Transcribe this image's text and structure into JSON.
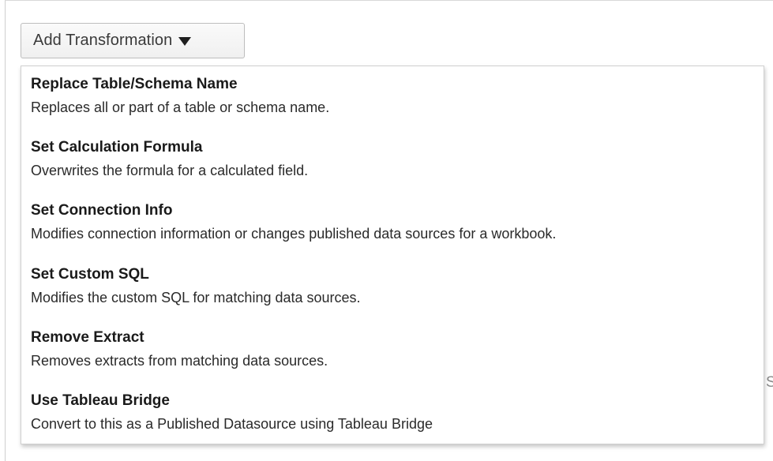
{
  "toolbar": {
    "add_transformation_label": "Add Transformation"
  },
  "menu": {
    "items": [
      {
        "title": "Replace Table/Schema Name",
        "description": "Replaces all or part of a table or schema name."
      },
      {
        "title": "Set Calculation Formula",
        "description": "Overwrites the formula for a calculated field."
      },
      {
        "title": "Set Connection Info",
        "description": "Modifies connection information or changes published data sources for a workbook."
      },
      {
        "title": "Set Custom SQL",
        "description": "Modifies the custom SQL for matching data sources."
      },
      {
        "title": "Remove Extract",
        "description": "Removes extracts from matching data sources."
      },
      {
        "title": "Use Tableau Bridge",
        "description": "Convert to this as a Published Datasource using Tableau Bridge"
      }
    ]
  },
  "background": {
    "partial_text": "S"
  }
}
